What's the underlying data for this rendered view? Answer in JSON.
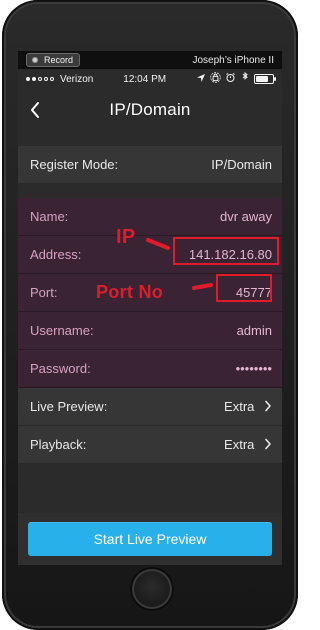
{
  "mirror_bar": {
    "record_label": "Record",
    "device_name": "Joseph’s iPhone II"
  },
  "status_bar": {
    "carrier": "Verizon",
    "time": "12:04 PM",
    "battery_level": 0.78
  },
  "nav": {
    "title": "IP/Domain"
  },
  "settings": {
    "register_mode": {
      "label": "Register Mode:",
      "value": "IP/Domain"
    },
    "name": {
      "label": "Name:",
      "value": "dvr away"
    },
    "address": {
      "label": "Address:",
      "value": "141.182.16.80"
    },
    "port": {
      "label": "Port:",
      "value": "45777"
    },
    "username": {
      "label": "Username:",
      "value": "admin"
    },
    "password": {
      "label": "Password:",
      "value": "••••••••"
    },
    "live_preview": {
      "label": "Live Preview:",
      "value": "Extra"
    },
    "playback": {
      "label": "Playback:",
      "value": "Extra"
    }
  },
  "annotations": {
    "ip_label": "IP",
    "port_label": "Port No",
    "color": "#e11b2c"
  },
  "cta": {
    "label": "Start Live Preview",
    "color": "#27b0ea"
  },
  "icons": {
    "back": "chevron-left-icon",
    "chevron_right": "chevron-right-icon",
    "location": "location-arrow-icon",
    "lock": "lock-rotation-icon",
    "alarm": "alarm-icon",
    "bluetooth": "bluetooth-icon",
    "battery": "battery-icon"
  }
}
